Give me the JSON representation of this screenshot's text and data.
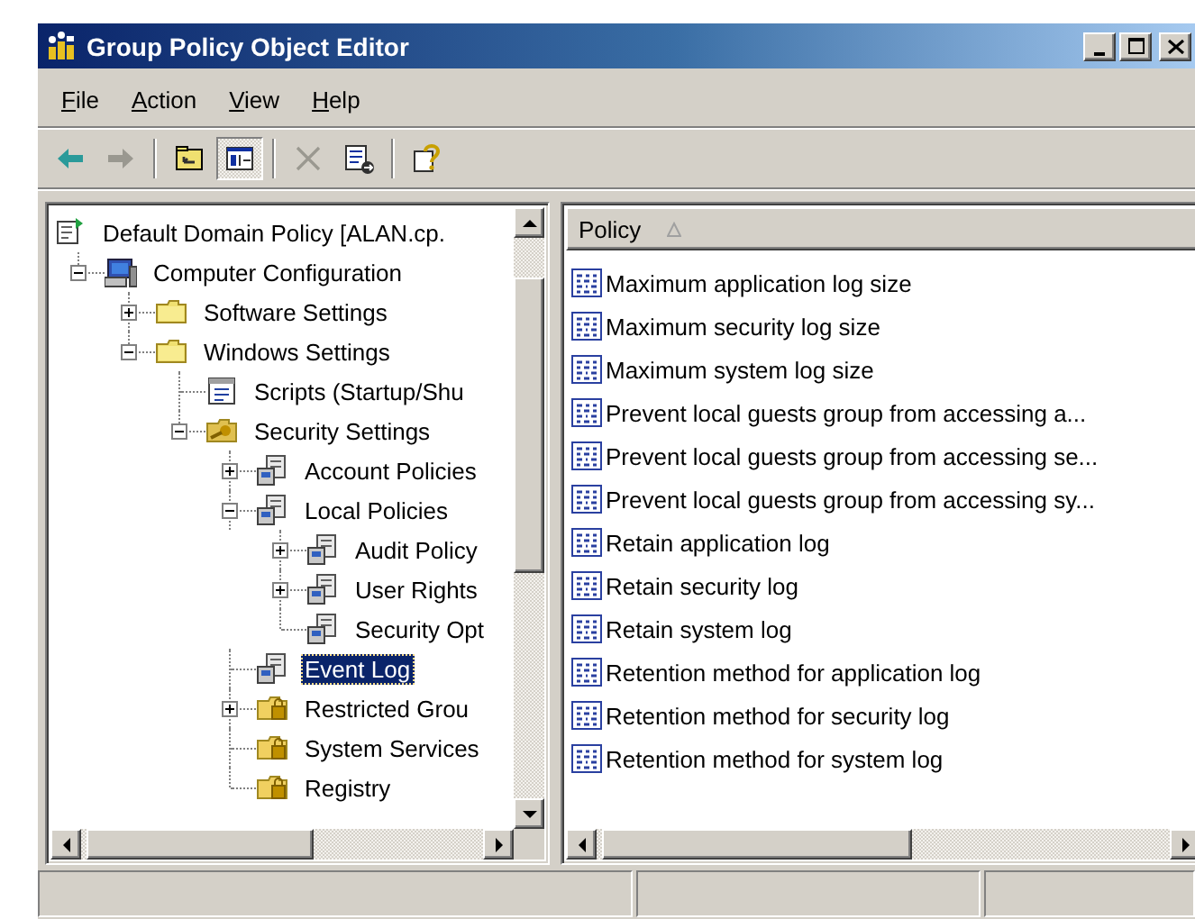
{
  "window": {
    "title": "Group Policy Object Editor"
  },
  "menu": [
    "File",
    "Action",
    "View",
    "Help"
  ],
  "toolbar": [
    [
      {
        "kind": "back",
        "disabled": false,
        "pressed": false
      },
      {
        "kind": "forward",
        "disabled": true,
        "pressed": false
      }
    ],
    [
      {
        "kind": "up",
        "disabled": false,
        "pressed": false
      },
      {
        "kind": "tree-toggle",
        "disabled": false,
        "pressed": true
      }
    ],
    [
      {
        "kind": "delete",
        "disabled": true,
        "pressed": false
      },
      {
        "kind": "export",
        "disabled": false,
        "pressed": false
      }
    ],
    [
      {
        "kind": "help",
        "disabled": false,
        "pressed": false
      }
    ]
  ],
  "tree": {
    "label": "Default Domain Policy [ALAN.cp.",
    "kind": "policy",
    "selected": false,
    "children": [
      {
        "label": "Computer Configuration",
        "kind": "computer",
        "expanded": true,
        "selected": false,
        "children": [
          {
            "label": "Software Settings",
            "kind": "folder",
            "expanded": false,
            "selected": false
          },
          {
            "label": "Windows Settings",
            "kind": "folder",
            "expanded": true,
            "selected": false,
            "children": [
              {
                "label": "Scripts (Startup/Shu",
                "kind": "scripts",
                "selected": false
              },
              {
                "label": "Security Settings",
                "kind": "security",
                "expanded": true,
                "selected": false,
                "children": [
                  {
                    "label": "Account Policies",
                    "kind": "policy-node",
                    "expanded": false,
                    "selected": false
                  },
                  {
                    "label": "Local Policies",
                    "kind": "policy-node",
                    "expanded": true,
                    "selected": false,
                    "children": [
                      {
                        "label": "Audit Policy",
                        "kind": "policy-node",
                        "expanded": false,
                        "selected": false
                      },
                      {
                        "label": "User Rights",
                        "kind": "policy-node",
                        "expanded": false,
                        "selected": false
                      },
                      {
                        "label": "Security Opt",
                        "kind": "policy-node",
                        "selected": false
                      }
                    ]
                  },
                  {
                    "label": "Event Log",
                    "kind": "policy-node",
                    "selected": true
                  },
                  {
                    "label": "Restricted Grou",
                    "kind": "lock-folder",
                    "expanded": false,
                    "selected": false
                  },
                  {
                    "label": "System Services",
                    "kind": "lock-folder",
                    "selected": false
                  },
                  {
                    "label": "Registry",
                    "kind": "lock-folder",
                    "selected": false
                  }
                ]
              }
            ]
          }
        ]
      }
    ]
  },
  "list": {
    "column": "Policy",
    "rows": [
      "Maximum application log size",
      "Maximum security log size",
      "Maximum system log size",
      "Prevent local guests group from accessing a...",
      "Prevent local guests group from accessing se...",
      "Prevent local guests group from accessing sy...",
      "Retain application log",
      "Retain security log",
      "Retain system log",
      "Retention method for application log",
      "Retention method for security log",
      "Retention method for system log"
    ]
  }
}
